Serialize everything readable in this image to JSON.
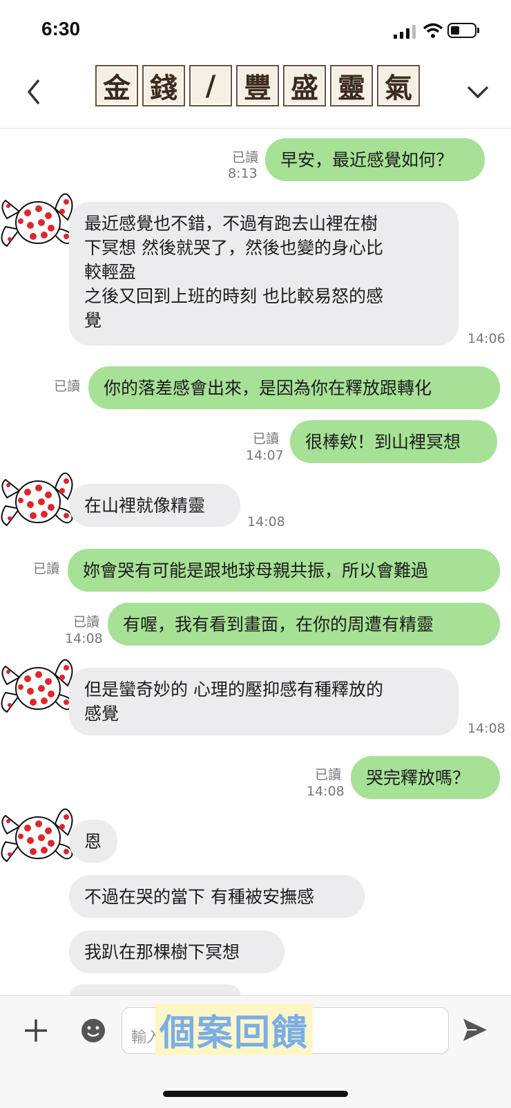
{
  "status": {
    "time": "6:30"
  },
  "header": {
    "title_chars": [
      "金",
      "錢",
      "/",
      "豐",
      "盛",
      "靈",
      "氣"
    ]
  },
  "messages": [
    {
      "from": "me",
      "text": "早安，最近感覺如何？",
      "read": "已讀",
      "time": "8:13"
    },
    {
      "from": "them",
      "text": "最近感覺也不錯，不過有跑去山裡在樹\n下冥想 然後就哭了，然後也變的身心比\n較輕盈\n之後又回到上班的時刻 也比較易怒的感\n覺",
      "time": "14:06"
    },
    {
      "from": "me",
      "text": "你的落差感會出來，是因為你在釋放跟轉化",
      "read": "已讀",
      "time": ""
    },
    {
      "from": "me",
      "text": "很棒欸！到山裡冥想",
      "read": "已讀",
      "time": "14:07"
    },
    {
      "from": "them",
      "text": "在山裡就像精靈",
      "time": "14:08"
    },
    {
      "from": "me",
      "text": "妳會哭有可能是跟地球母親共振，所以會難過",
      "read": "已讀",
      "time": ""
    },
    {
      "from": "me",
      "text": "有喔，我有看到畫面，在你的周遭有精靈",
      "read": "已讀",
      "time": "14:08"
    },
    {
      "from": "them",
      "text": "但是蠻奇妙的 心理的壓抑感有種釋放的\n感覺",
      "time": "14:08"
    },
    {
      "from": "me",
      "text": "哭完釋放嗎？",
      "read": "已讀",
      "time": "14:08"
    },
    {
      "from": "them",
      "text": "恩",
      "time": ""
    },
    {
      "from": "them",
      "text": "不過在哭的當下 有種被安撫感",
      "time": ""
    },
    {
      "from": "them",
      "text": "我趴在那棵樹下冥想",
      "time": ""
    }
  ],
  "input": {
    "placeholder": "輸入",
    "overlay_label": "個案回饋"
  },
  "colors": {
    "outgoing": "#a6e196",
    "incoming": "#ececef"
  }
}
